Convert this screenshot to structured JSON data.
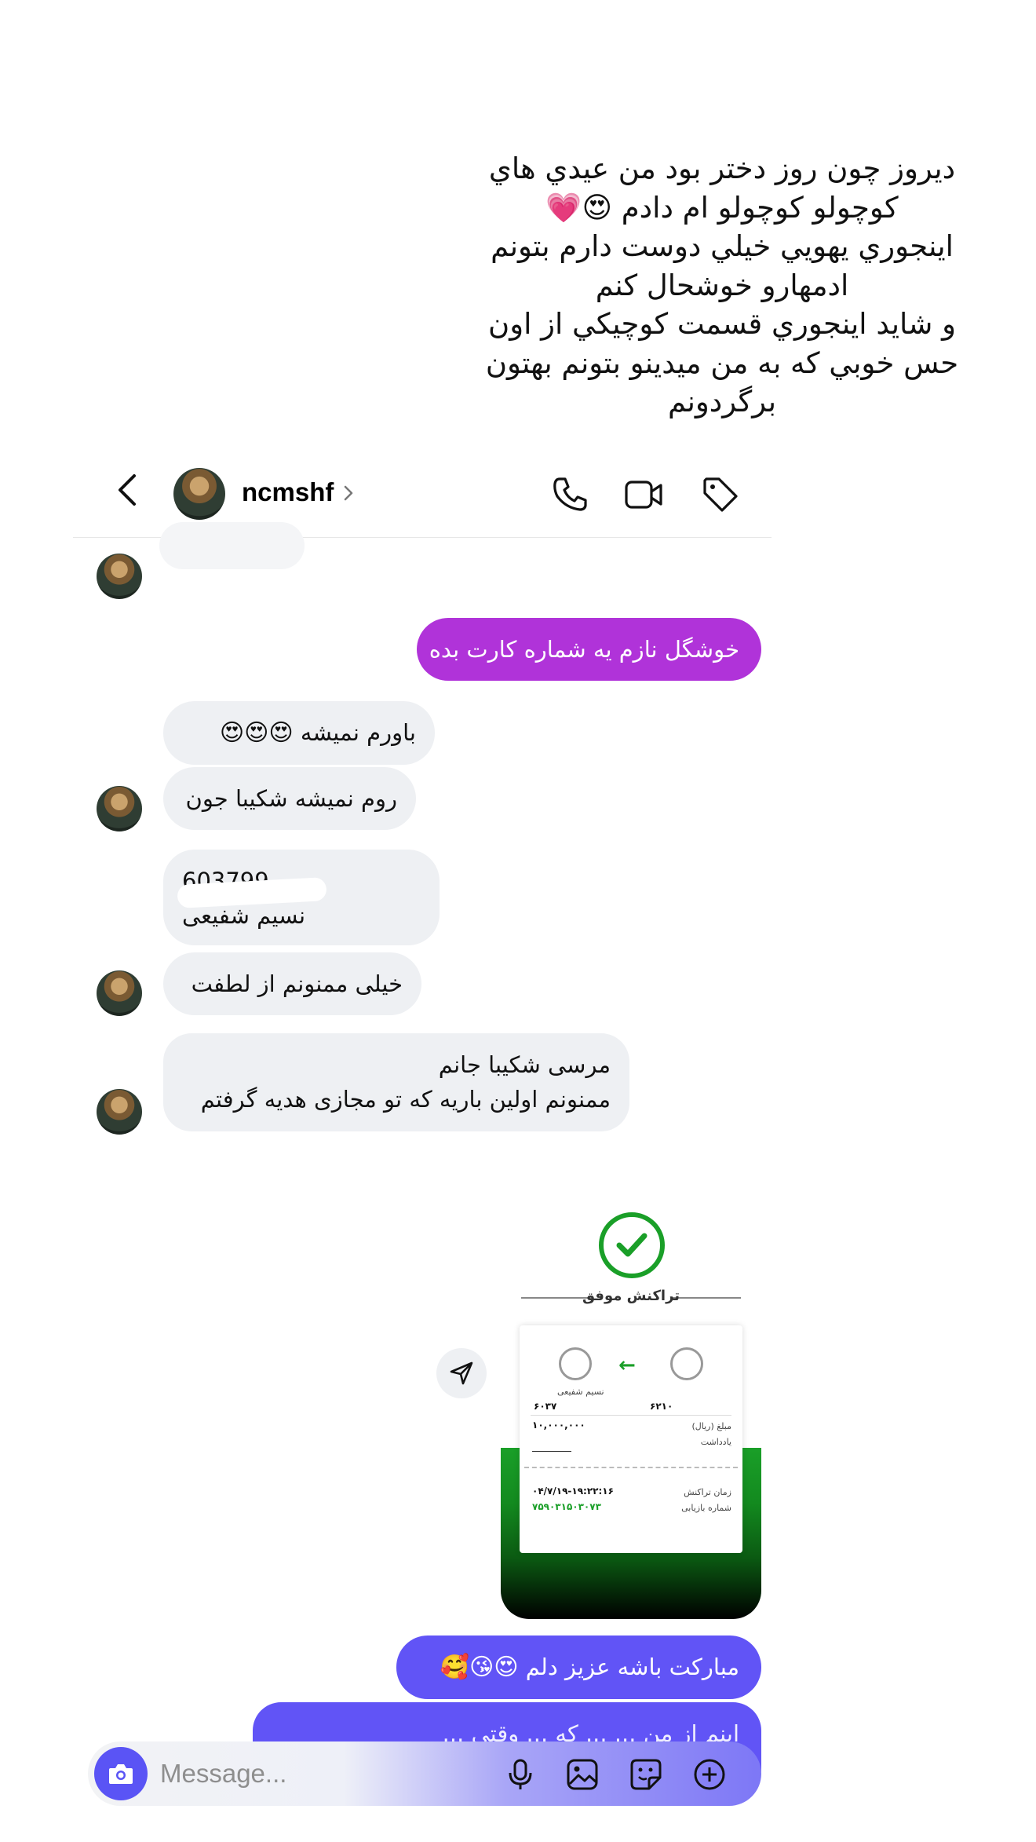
{
  "caption": {
    "lines": [
      "ديروز چون روز دختر بود من عيدي هاي",
      "كوچولو كوچولو ام دادم 😍💗",
      "اينجوري يهويي خيلي دوست دارم بتونم",
      "ادمهارو خوشحال كنم",
      "و شايد اينجوري قسمت كوچيكي از اون",
      "حس خوبي كه به من ميدينو بتونم بهتون",
      "برگردونم"
    ]
  },
  "header": {
    "username": "ncmshf"
  },
  "messages": {
    "m1": "خوشگل نازم یه شماره کارت بده",
    "m2_text": "باورم نمیشه",
    "m2_emoji": "😍😍😍",
    "m3": "روم نمیشه شکیبا جون",
    "m4_line1": "603799",
    "m4_line2": "نسیم شفیعی",
    "m5": "خیلی ممنونم از لطفت",
    "m6_line1": "مرسی شکیبا جانم",
    "m6_line2": "ممنونم اولین باریه که تو مجازی هدیه گرفتم",
    "m7_text": "مبارکت باشه عزیز دلم",
    "m7_emoji": "😍😘🥰",
    "m8_partial": "اینم از من ... ... که ... وقتی ..."
  },
  "receipt": {
    "status": "تراکنش موفق",
    "sender_name": "نسیم شفیعی",
    "card_left": "۶۰۳۷",
    "card_right": "۶۲۱۰",
    "amount_label": "مبلغ (ریال)",
    "amount": "۱۰,۰۰۰,۰۰۰",
    "note_label": "یادداشت",
    "time_label": "زمان تراکنش",
    "time_value": "۰۴/۷/۱۹-۱۹:۲۲:۱۶",
    "tracking_label": "شماره بازیابی",
    "tracking_value": "۷۵۹۰۳۱۵۰۳۰۷۳"
  },
  "composer": {
    "placeholder": "Message..."
  },
  "colors": {
    "accent_purple": "#b033d9",
    "accent_blue": "#6154f6",
    "success_green": "#1a9f28"
  }
}
